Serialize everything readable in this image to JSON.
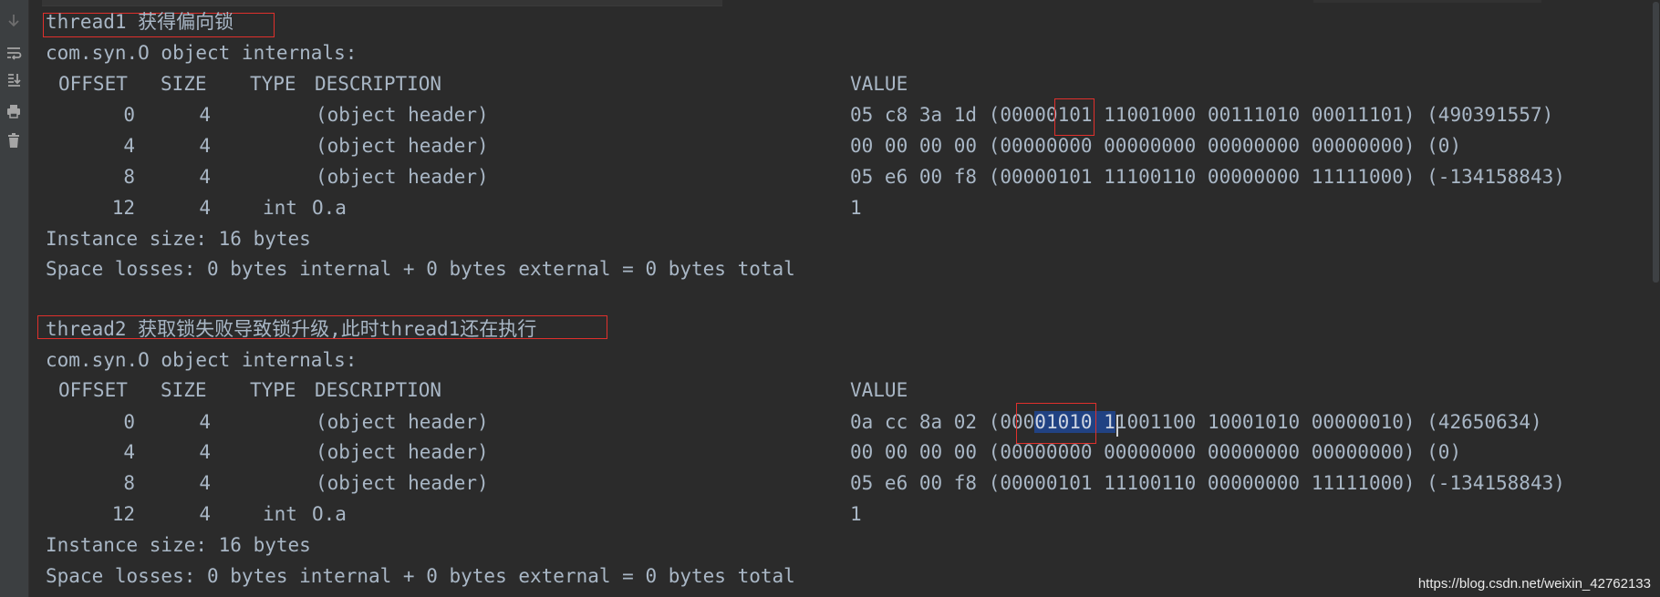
{
  "gutter": {
    "icons": [
      "arrow-down-icon",
      "soft-wrap-icon",
      "scroll-to-end-icon",
      "print-icon",
      "trash-icon"
    ]
  },
  "console": {
    "block1": {
      "heading": "thread1 获得偏向锁",
      "internals": "com.syn.O object internals:",
      "headers": {
        "offset": "OFFSET",
        "size": "SIZE",
        "type": "TYPE",
        "description": "DESCRIPTION",
        "value": "VALUE"
      },
      "rows": [
        {
          "offset": "0",
          "size": "4",
          "type": "",
          "description": "(object header)",
          "value_pre": "05 c8 3a 1d (00000",
          "value_mark": "101",
          "value_post": " 11001000 00111010 00011101) (490391557)"
        },
        {
          "offset": "4",
          "size": "4",
          "type": "",
          "description": "(object header)",
          "value_pre": "00 00 00 00 (00000000 00000000 00000000 00000000) (0)",
          "value_mark": "",
          "value_post": ""
        },
        {
          "offset": "8",
          "size": "4",
          "type": "",
          "description": "(object header)",
          "value_pre": "05 e6 00 f8 (00000101 11100110 00000000 11111000) (-134158843)",
          "value_mark": "",
          "value_post": ""
        },
        {
          "offset": "12",
          "size": "4",
          "type": "int",
          "description": "O.a",
          "value_pre": "1",
          "value_mark": "",
          "value_post": ""
        }
      ],
      "instance_size": "Instance size: 16 bytes",
      "space_losses": "Space losses: 0 bytes internal + 0 bytes external = 0 bytes total"
    },
    "block2": {
      "heading": "thread2 获取锁失败导致锁升级,此时thread1还在执行",
      "internals": "com.syn.O object internals:",
      "headers": {
        "offset": "OFFSET",
        "size": "SIZE",
        "type": "TYPE",
        "description": "DESCRIPTION",
        "value": "VALUE"
      },
      "rows": [
        {
          "offset": "0",
          "size": "4",
          "type": "",
          "description": "(object header)",
          "value_pre": "0a cc 8a 02 (000",
          "value_mark": "01010 1",
          "value_post": "1001100 10001010 00000010) (42650634)"
        },
        {
          "offset": "4",
          "size": "4",
          "type": "",
          "description": "(object header)",
          "value_pre": "00 00 00 00 (00000000 00000000 00000000 00000000) (0)",
          "value_mark": "",
          "value_post": ""
        },
        {
          "offset": "8",
          "size": "4",
          "type": "",
          "description": "(object header)",
          "value_pre": "05 e6 00 f8 (00000101 11100110 00000000 11111000) (-134158843)",
          "value_mark": "",
          "value_post": ""
        },
        {
          "offset": "12",
          "size": "4",
          "type": "int",
          "description": "O.a",
          "value_pre": "1",
          "value_mark": "",
          "value_post": ""
        }
      ],
      "instance_size": "Instance size: 16 bytes",
      "space_losses": "Space losses: 0 bytes internal + 0 bytes external = 0 bytes total"
    }
  },
  "watermark": "https://blog.csdn.net/weixin_42762133",
  "colors": {
    "background": "#2b2b2b",
    "text": "#a9b7c6",
    "annotation_box": "#e0302c",
    "selection": "#214283"
  }
}
